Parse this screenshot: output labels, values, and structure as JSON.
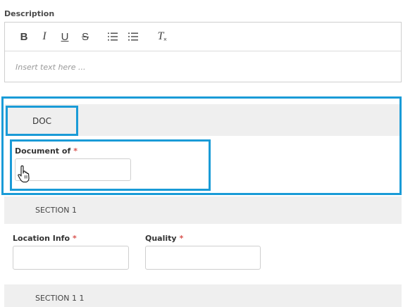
{
  "description": {
    "label": "Description",
    "placeholder": "Insert text here ...",
    "toolbar": [
      {
        "name": "bold-icon",
        "glyph": "B"
      },
      {
        "name": "italic-icon",
        "glyph": "I"
      },
      {
        "name": "underline-icon",
        "glyph": "U"
      },
      {
        "name": "strikethrough-icon",
        "glyph": "S"
      },
      {
        "name": "ordered-list-icon",
        "glyph": ""
      },
      {
        "name": "bullet-list-icon",
        "glyph": ""
      },
      {
        "name": "clear-format-icon",
        "glyph": "T"
      }
    ]
  },
  "doc_section": {
    "tab_label": "DOC",
    "document_of": {
      "label": "Document of",
      "required": "*",
      "value": ""
    }
  },
  "section1": {
    "title": "SECTION 1",
    "location_info": {
      "label": "Location Info",
      "required": "*",
      "value": ""
    },
    "quality": {
      "label": "Quality",
      "required": "*",
      "value": ""
    }
  },
  "section11": {
    "title": "SECTION 1 1"
  },
  "colors": {
    "highlight": "#1a9bd7",
    "required": "#d9534f",
    "section_bg": "#efefef"
  }
}
